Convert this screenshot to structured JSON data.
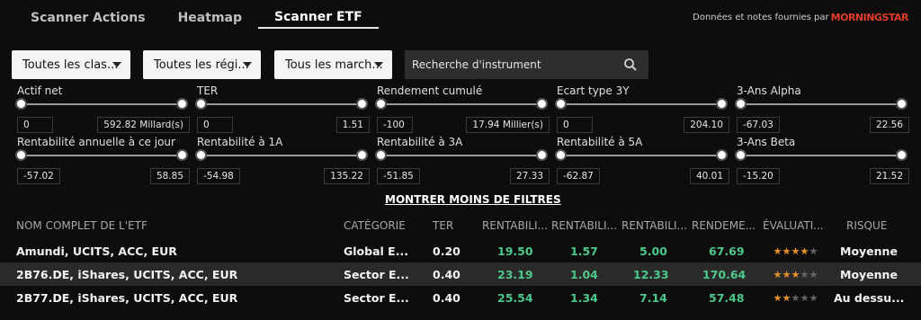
{
  "tabs": [
    {
      "label": "Scanner Actions",
      "active": false
    },
    {
      "label": "Heatmap",
      "active": false
    },
    {
      "label": "Scanner ETF",
      "active": true
    }
  ],
  "provider": {
    "text": "Données et notes fournies par",
    "logo": "MORNINGSTAR"
  },
  "dropdowns": [
    {
      "value": "Toutes les clas..."
    },
    {
      "value": "Toutes les régi..."
    },
    {
      "value": "Tous les march..."
    }
  ],
  "search": {
    "placeholder": "Recherche d'instrument",
    "icon": "search-icon"
  },
  "filters": [
    {
      "label": "Actif net",
      "min": "0",
      "max": "592.82 Millard(s)"
    },
    {
      "label": "TER",
      "min": "0",
      "max": "1.51"
    },
    {
      "label": "Rendement cumulé",
      "min": "-100",
      "max": "17.94 Millier(s)"
    },
    {
      "label": "Ecart type 3Y",
      "min": "0",
      "max": "204.10"
    },
    {
      "label": "3-Ans Alpha",
      "min": "-67.03",
      "max": "22.56"
    },
    {
      "label": "Rentabilité annuelle à ce jour",
      "min": "-57.02",
      "max": "58.85"
    },
    {
      "label": "Rentabilité à 1A",
      "min": "-54.98",
      "max": "135.22"
    },
    {
      "label": "Rentabilité à 3A",
      "min": "-51.85",
      "max": "27.33"
    },
    {
      "label": "Rentabilité à 5A",
      "min": "-62.87",
      "max": "40.01"
    },
    {
      "label": "3-Ans Beta",
      "min": "-15.20",
      "max": "21.52"
    }
  ],
  "toggle_filters": "MONTRER MOINS DE FILTRES",
  "table": {
    "headers": [
      "NOM COMPLET DE L'ETF",
      "CATÉGORIE",
      "TER",
      "RENTABILI...",
      "RENTABILI...",
      "RENTABILI...",
      "RENDEME...",
      "ÉVALUATI...",
      "RISQUE"
    ],
    "rows": [
      {
        "name": "Amundi, UCITS, ACC, EUR",
        "category": "Global E...",
        "ter": "0.20",
        "r1": "19.50",
        "r2": "1.57",
        "r3": "5.00",
        "rend": "67.69",
        "stars": 4,
        "risk": "Moyenne"
      },
      {
        "name": "2B76.DE, iShares, UCITS, ACC, EUR",
        "category": "Sector E...",
        "ter": "0.40",
        "r1": "23.19",
        "r2": "1.04",
        "r3": "12.33",
        "rend": "170.64",
        "stars": 3,
        "risk": "Moyenne"
      },
      {
        "name": "2B77.DE, iShares, UCITS, ACC, EUR",
        "category": "Sector E...",
        "ter": "0.40",
        "r1": "25.54",
        "r2": "1.34",
        "r3": "7.14",
        "rend": "57.48",
        "stars": 2,
        "risk": "Au dessu..."
      }
    ]
  },
  "colors": {
    "positive": "#4dc88a",
    "star_on": "#e8902a",
    "star_off": "#666666",
    "logo": "#e23b2a"
  }
}
